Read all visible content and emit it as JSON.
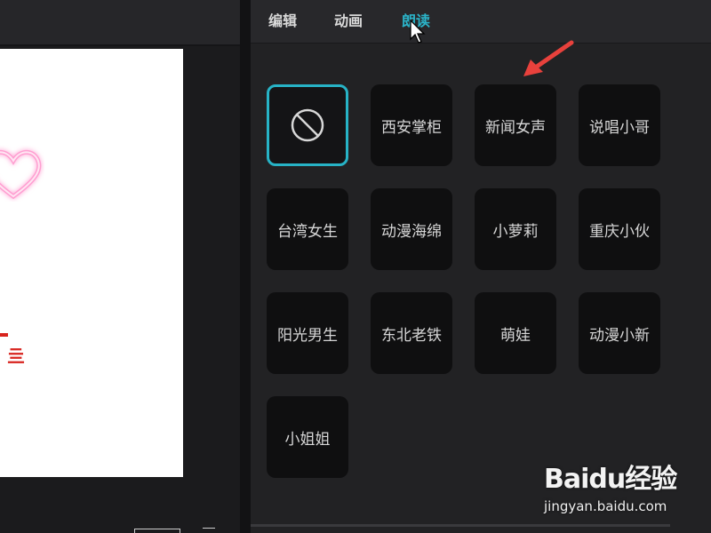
{
  "tabs": {
    "edit": "编辑",
    "animation": "动画",
    "read": "朗读"
  },
  "voices": [
    {
      "label": "",
      "icon": "none-prohibit-icon",
      "selected": true
    },
    {
      "label": "西安掌柜",
      "selected": false
    },
    {
      "label": "新闻女声",
      "selected": false
    },
    {
      "label": "说唱小哥",
      "selected": false
    },
    {
      "label": "台湾女生",
      "selected": false
    },
    {
      "label": "动漫海绵",
      "selected": false
    },
    {
      "label": "小萝莉",
      "selected": false
    },
    {
      "label": "重庆小伙",
      "selected": false
    },
    {
      "label": "阳光男生",
      "selected": false
    },
    {
      "label": "东北老铁",
      "selected": false
    },
    {
      "label": "萌娃",
      "selected": false
    },
    {
      "label": "动漫小新",
      "selected": false
    },
    {
      "label": "小姐姐",
      "selected": false
    }
  ],
  "preview": {
    "red_text": "亖"
  },
  "watermark": {
    "logo": "Baidu经验",
    "url": "jingyan.baidu.com"
  },
  "colors": {
    "accent": "#2bb3c8",
    "tile_bg": "#0f0f10",
    "panel_bg": "#222224",
    "arrow": "#e8413c"
  }
}
